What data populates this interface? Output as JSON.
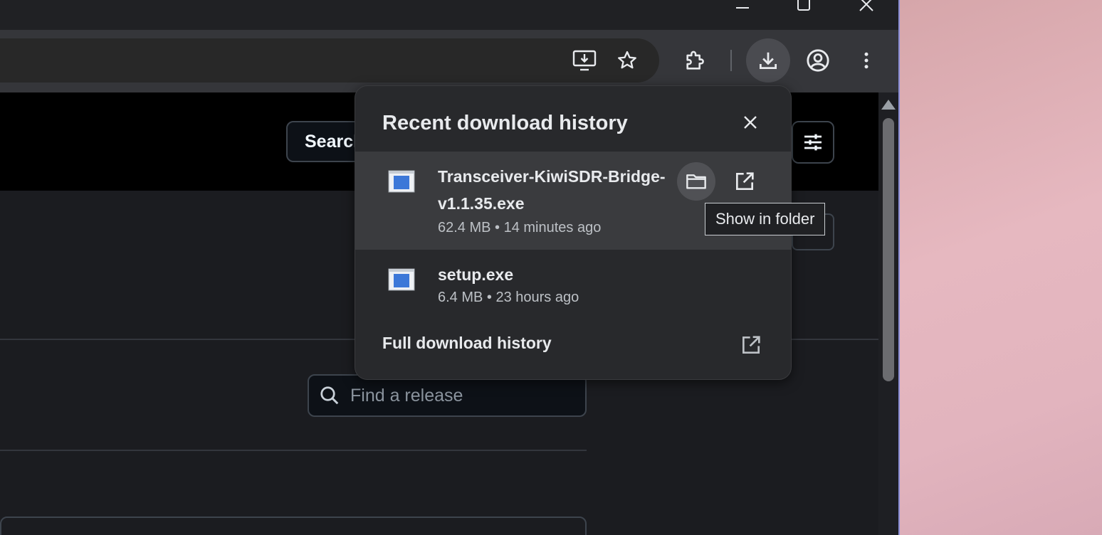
{
  "window": {
    "controls": {
      "minimize_icon": "minimize-icon",
      "maximize_icon": "maximize-icon",
      "close_icon": "close-icon"
    }
  },
  "toolbar": {
    "icons": [
      "install-app-icon",
      "bookmark-star-icon",
      "extensions-icon",
      "download-icon",
      "profile-icon",
      "more-vert-icon"
    ]
  },
  "page": {
    "search_button_label": "Search",
    "find_release_placeholder": "Find a release"
  },
  "downloads_bubble": {
    "title": "Recent download history",
    "items": [
      {
        "name_line1": "Transceiver-KiwiSDR-Bridge-",
        "name_line2": "v1.1.35.exe",
        "meta": "62.4 MB • 14 minutes ago"
      },
      {
        "name_line1": "setup.exe",
        "meta": "6.4 MB • 23 hours ago"
      }
    ],
    "full_history_label": "Full download history"
  },
  "tooltip": {
    "text": "Show in folder"
  },
  "colors": {
    "accent_file_icon": "#3c78d8",
    "bubble_bg": "#28292c",
    "hover_row_bg": "#3a3b3e"
  }
}
